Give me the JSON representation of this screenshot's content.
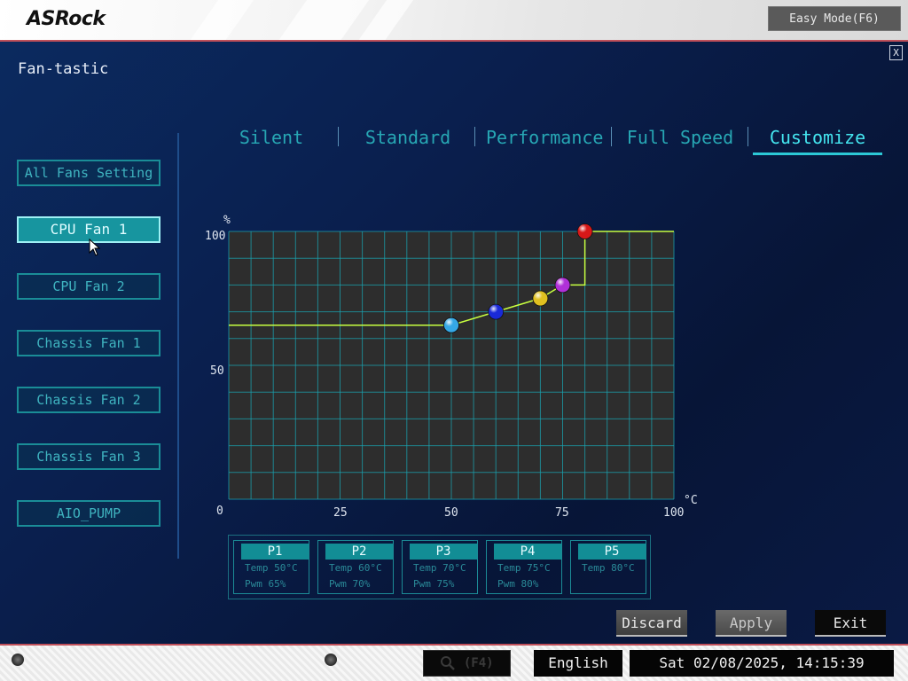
{
  "brand": {
    "logo_text": "ASRock"
  },
  "header": {
    "easy_mode_label": "Easy Mode(F6)"
  },
  "page": {
    "title": "Fan-tastic",
    "close_label": "X"
  },
  "tabs": [
    {
      "label": "Silent",
      "active": false
    },
    {
      "label": "Standard",
      "active": false
    },
    {
      "label": "Performance",
      "active": false
    },
    {
      "label": "Full Speed",
      "active": false
    },
    {
      "label": "Customize",
      "active": true
    }
  ],
  "fans": [
    {
      "label": "All Fans Setting",
      "active": false
    },
    {
      "label": "CPU Fan 1",
      "active": true
    },
    {
      "label": "CPU Fan 2",
      "active": false
    },
    {
      "label": "Chassis Fan 1",
      "active": false
    },
    {
      "label": "Chassis Fan 2",
      "active": false
    },
    {
      "label": "Chassis Fan 3",
      "active": false
    },
    {
      "label": "AIO_PUMP",
      "active": false
    }
  ],
  "chart_data": {
    "type": "line",
    "ylabel": "%",
    "xlabel": "°C",
    "xlim": [
      0,
      100
    ],
    "ylim": [
      0,
      100
    ],
    "x_ticks": [
      "25",
      "50",
      "75",
      "100"
    ],
    "y_ticks": [
      "100",
      "50",
      "0"
    ],
    "grid": true,
    "points": [
      {
        "name": "P1",
        "temp": 50,
        "pwm": 65,
        "color": "#35a8e6"
      },
      {
        "name": "P2",
        "temp": 60,
        "pwm": 70,
        "color": "#1a2ad8"
      },
      {
        "name": "P3",
        "temp": 70,
        "pwm": 75,
        "color": "#e0c020"
      },
      {
        "name": "P4",
        "temp": 75,
        "pwm": 80,
        "color": "#b030d8"
      },
      {
        "name": "P5",
        "temp": 80,
        "pwm": 100,
        "color": "#d81818"
      }
    ],
    "curve": [
      [
        0,
        65
      ],
      [
        50,
        65
      ],
      [
        60,
        70
      ],
      [
        70,
        75
      ],
      [
        75,
        80
      ],
      [
        80,
        80
      ],
      [
        80,
        100
      ],
      [
        100,
        100
      ]
    ]
  },
  "points_panel": [
    {
      "name": "P1",
      "temp": "Temp 50°C",
      "pwm": "Pwm  65%"
    },
    {
      "name": "P2",
      "temp": "Temp 60°C",
      "pwm": "Pwm  70%"
    },
    {
      "name": "P3",
      "temp": "Temp 70°C",
      "pwm": "Pwm  75%"
    },
    {
      "name": "P4",
      "temp": "Temp 75°C",
      "pwm": "Pwm  80%"
    },
    {
      "name": "P5",
      "temp": "Temp 80°C",
      "pwm": ""
    }
  ],
  "actions": {
    "discard": "Discard",
    "apply": "Apply",
    "exit": "Exit"
  },
  "footer": {
    "search_label": "(F4)",
    "language": "English",
    "datetime": "Sat 02/08/2025, 14:15:39"
  },
  "colors": {
    "accent": "#2cc8d6",
    "curve": "#c8ff40",
    "grid_line": "#1aa3b0"
  }
}
